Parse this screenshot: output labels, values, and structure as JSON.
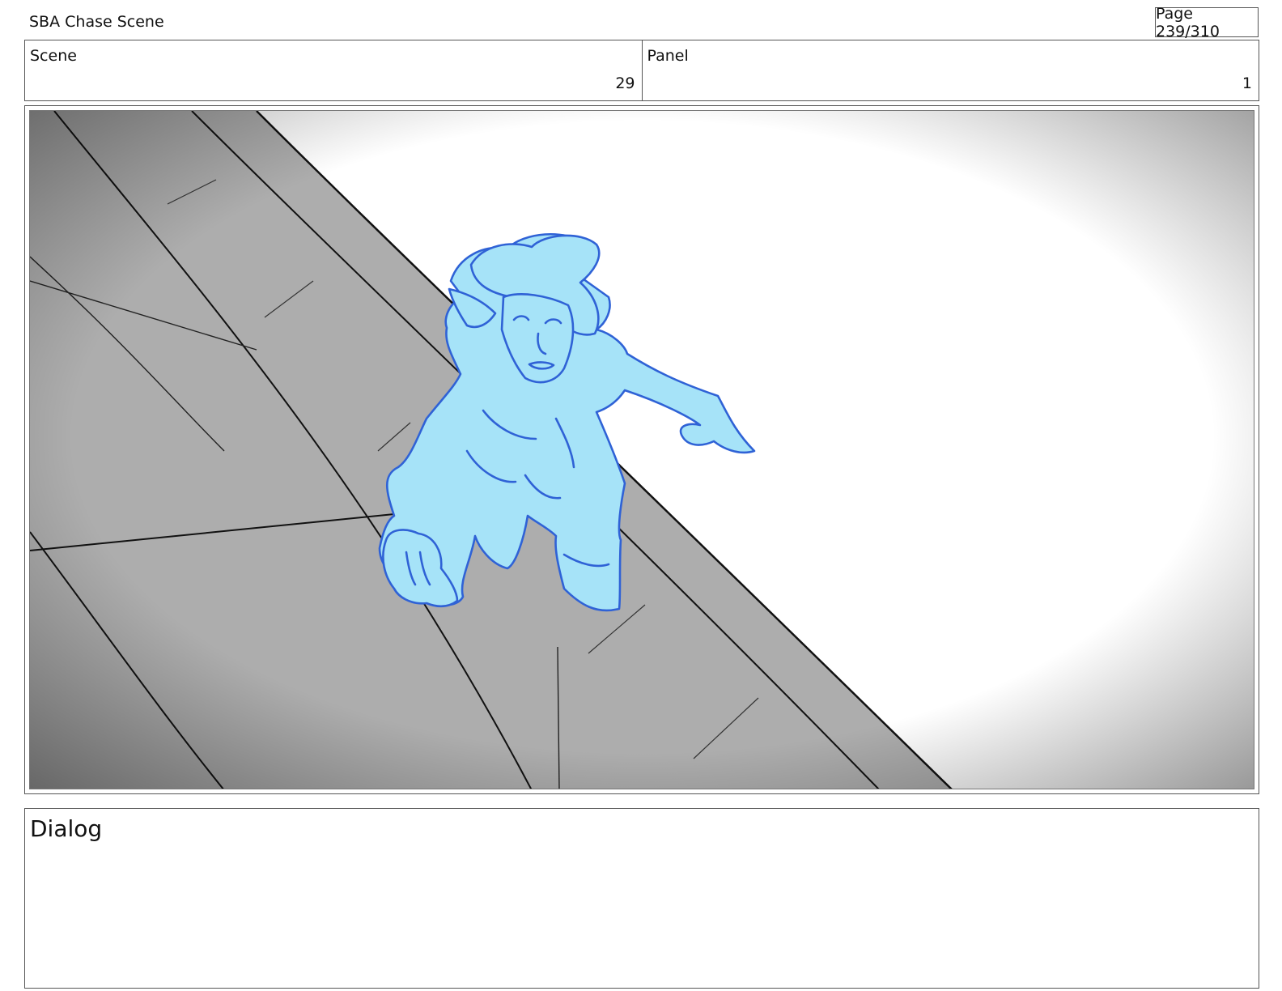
{
  "header": {
    "project_title": "SBA Chase Scene",
    "page_indicator": "Page 239/310"
  },
  "info": {
    "scene_label": "Scene",
    "scene_value": "29",
    "panel_label": "Panel",
    "panel_value": "1"
  },
  "frame": {
    "character_fill": "#a6e3f8",
    "character_line": "#2f62d6",
    "ground_color": "#adadad"
  },
  "dialog": {
    "label": "Dialog"
  }
}
